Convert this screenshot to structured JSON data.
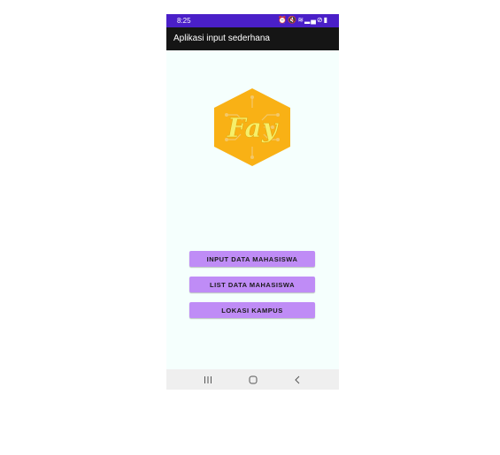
{
  "status_bar": {
    "time": "8:25",
    "icons": [
      "alarm-icon",
      "mute-icon",
      "wifi-icon",
      "signal-icon",
      "do-not-disturb-icon",
      "battery-icon"
    ]
  },
  "app_bar": {
    "title": "Aplikasi input sederhana"
  },
  "logo": {
    "text": "Fay",
    "colors": {
      "hexagon": "#f9b115",
      "text": "#f6ef6a",
      "circuit": "#f3c86a"
    }
  },
  "buttons": {
    "input_label": "INPUT DATA MAHASISWA",
    "list_label": "LIST DATA MAHASISWA",
    "location_label": "LOKASI KAMPUS"
  },
  "nav_bar": {
    "icons": [
      "recents-icon",
      "home-icon",
      "back-icon"
    ]
  },
  "colors": {
    "status_bar": "#4a1fc8",
    "app_bar": "#151515",
    "background": "#f5fffd",
    "button": "#bf8cf6",
    "nav_bar": "#efefef"
  }
}
